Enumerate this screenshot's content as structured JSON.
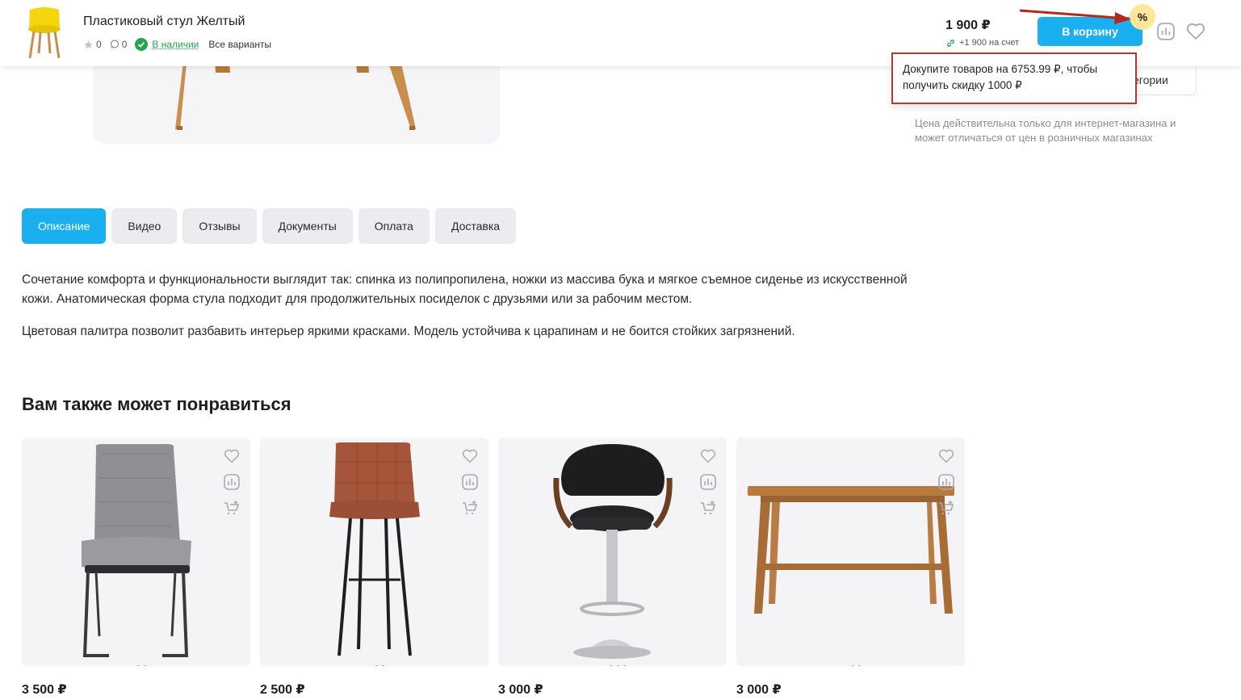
{
  "product": {
    "title": "Пластиковый стул Желтый",
    "rating_count": "0",
    "comments_count": "0",
    "availability": "В наличии",
    "variants_link": "Все варианты",
    "price": "1 900 ₽",
    "bonus": "+1 900 на счет",
    "cart_label": "В корзину",
    "discount_symbol": "%"
  },
  "tooltip": {
    "text": "Докупите товаров на 6753.99 ₽, чтобы получить скидку 1000 ₽"
  },
  "side": {
    "category_label": "егории",
    "price_note": "Цена действительна только для интернет-магазина и может отличаться от цен в розничных магазинах"
  },
  "tabs": [
    {
      "label": "Описание",
      "active": true
    },
    {
      "label": "Видео"
    },
    {
      "label": "Отзывы"
    },
    {
      "label": "Документы"
    },
    {
      "label": "Оплата"
    },
    {
      "label": "Доставка"
    }
  ],
  "description": {
    "p1": "Сочетание комфорта и функциональности выглядит так: спинка из полипропилена, ножки из массива бука и мягкое съемное сиденье из искусственной кожи. Анатомическая форма стула подходит для продолжительных посиделок с друзьями или за рабочим местом.",
    "p2": "Цветовая палитра позволит разбавить интерьер яркими красками. Модель устойчива к царапинам и не боится стойких загрязнений."
  },
  "recommendations": {
    "title": "Вам также может понравиться",
    "items": [
      {
        "price": "3 500 ₽",
        "image": "grey-upholstered-chair"
      },
      {
        "price": "2 500 ₽",
        "image": "brown-bar-stool"
      },
      {
        "price": "3 000 ₽",
        "image": "black-swivel-bar-chair"
      },
      {
        "price": "3 000 ₽",
        "image": "wooden-bench"
      }
    ]
  },
  "colors": {
    "accent": "#1ab0f0",
    "stock_green": "#23a650",
    "tooltip_border": "#b23a2e",
    "badge": "#fde89a"
  }
}
